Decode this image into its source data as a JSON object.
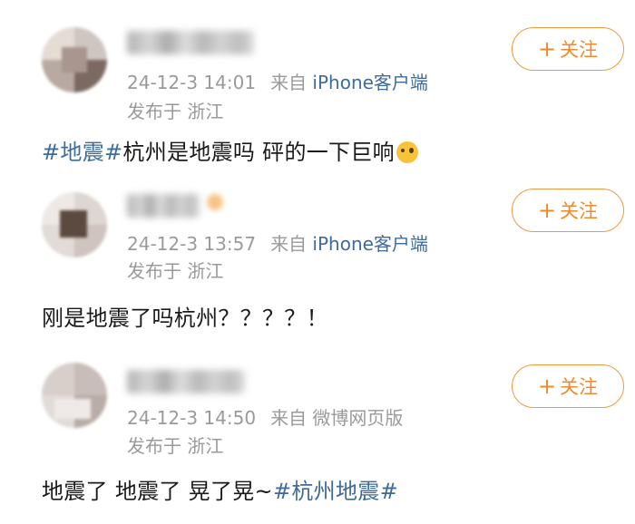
{
  "posts": [
    {
      "time": "24-12-3 14:01",
      "source_prefix": "来自 ",
      "client": "iPhone客户端",
      "location": "发布于 浙江",
      "follow_label": "关注",
      "follow_plus": "+",
      "content": {
        "tag": "#地震#",
        "text": "杭州是地震吗 砰的一下巨响",
        "emoji": "thinking-face-emoji"
      }
    },
    {
      "time": "24-12-3 13:57",
      "source_prefix": "来自 ",
      "client": "iPhone客户端",
      "location": "发布于 浙江",
      "follow_label": "关注",
      "follow_plus": "+",
      "content": {
        "text": "刚是地震了吗杭州？？？？！"
      }
    },
    {
      "time": "24-12-3 14:50",
      "source_prefix": "来自 ",
      "client": "微博网页版",
      "location": "发布于 浙江",
      "follow_label": "关注",
      "follow_plus": "+",
      "content": {
        "text": "地震了 地震了 晃了晃~",
        "tag": "#杭州地震#"
      }
    }
  ],
  "colors": {
    "accent_orange": "#ef8a2a",
    "link_blue": "#3f6b9a",
    "meta_gray": "#9a9a9a"
  }
}
